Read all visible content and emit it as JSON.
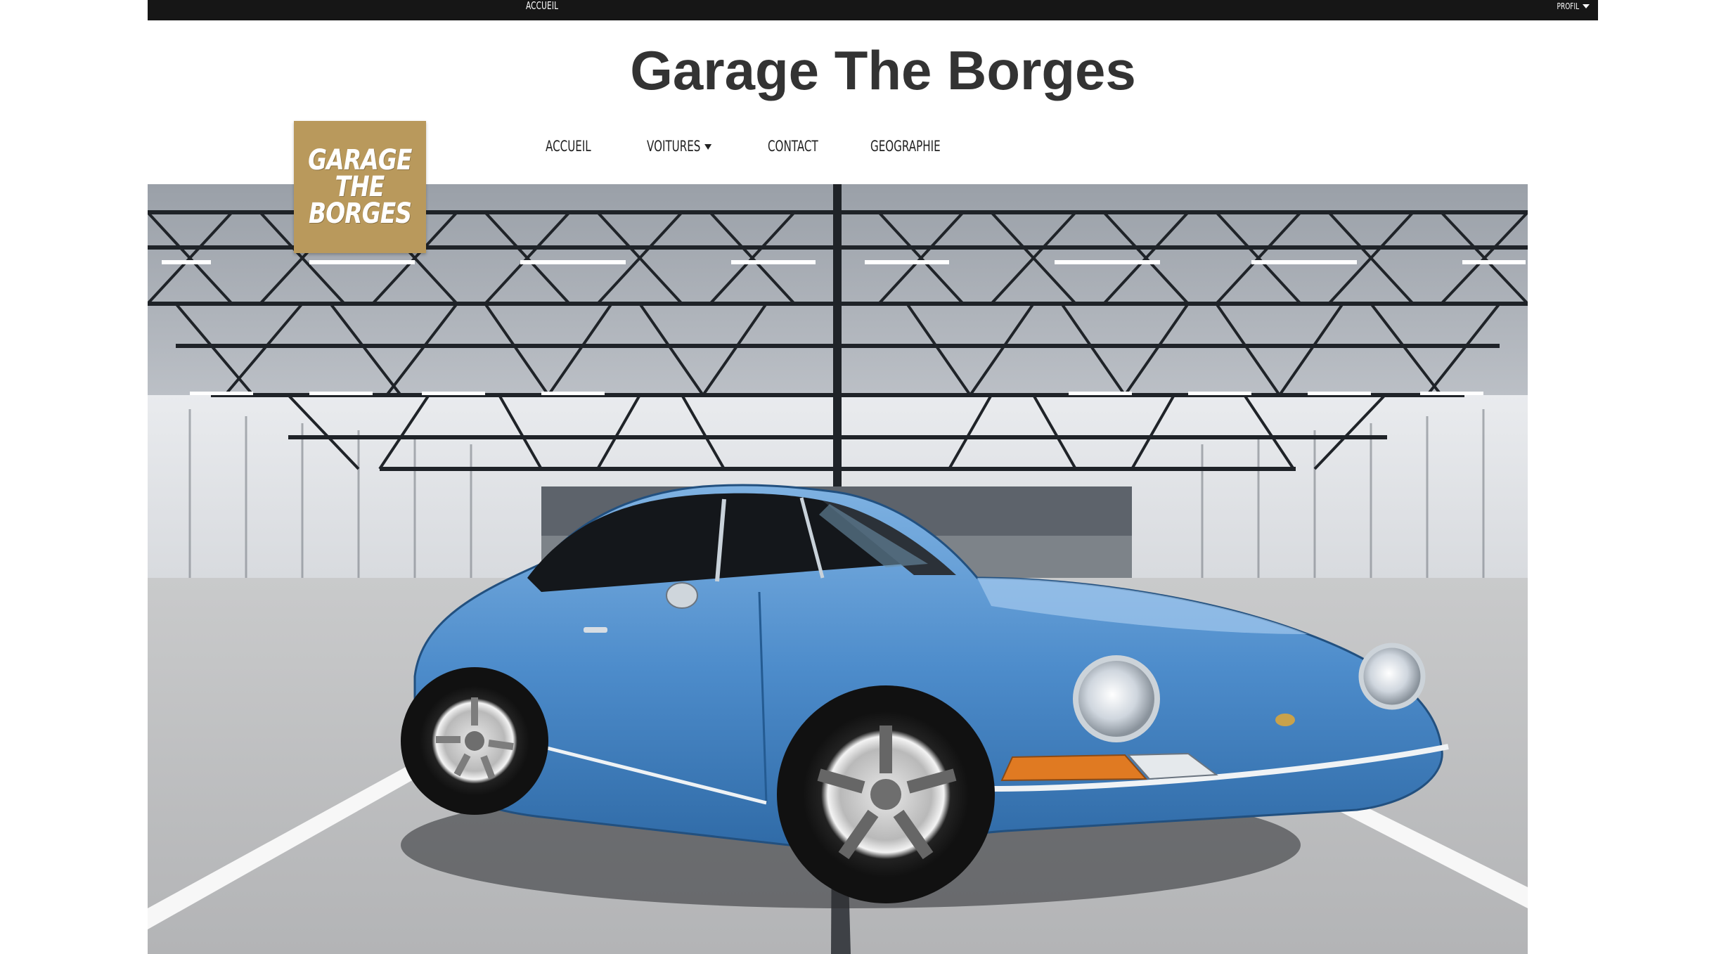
{
  "topbar": {
    "home_link": "ACCUEIL",
    "profile_label": "PROFIL"
  },
  "site": {
    "title": "Garage The Borges"
  },
  "logo": {
    "lines": [
      "GARAGE",
      "THE",
      "BORGES"
    ],
    "bg_color": "#b9995c"
  },
  "nav": {
    "items": [
      {
        "label": "ACCUEIL",
        "has_dropdown": false
      },
      {
        "label": "VOITURES",
        "has_dropdown": true
      },
      {
        "label": "CONTACT",
        "has_dropdown": false
      },
      {
        "label": "GEOGRAPHIE",
        "has_dropdown": false
      }
    ]
  },
  "hero": {
    "subject": "hero-image-blue-porsche-911",
    "car_color": "#4d8ccb"
  },
  "colors": {
    "topbar_bg": "#161616",
    "title_text": "#333333",
    "nav_text": "#222222"
  }
}
